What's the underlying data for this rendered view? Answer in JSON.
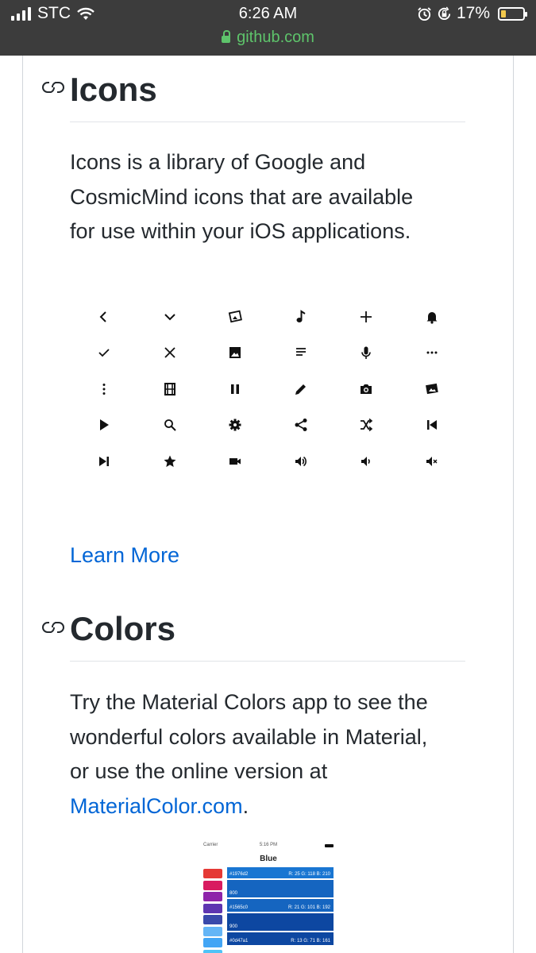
{
  "status_bar": {
    "carrier": "STC",
    "time": "6:26 AM",
    "battery": "17%",
    "url": "github.com"
  },
  "sections": {
    "icons": {
      "heading": "Icons",
      "line1": "Icons is a library of Google and",
      "line2": "CosmicMind icons that are available",
      "line3": "for use within your iOS applications.",
      "learn_more": "Learn More",
      "grid": [
        "chevron-left-icon",
        "chevron-down-icon",
        "photo-library-icon",
        "music-note-icon",
        "plus-icon",
        "bell-icon",
        "check-icon",
        "close-icon",
        "image-icon",
        "menu-lines-icon",
        "microphone-icon",
        "more-horizontal-icon",
        "more-vertical-icon",
        "movie-icon",
        "pause-icon",
        "pencil-icon",
        "camera-icon",
        "photo-library-icon",
        "play-icon",
        "search-icon",
        "settings-icon",
        "share-icon",
        "shuffle-icon",
        "skip-back-icon",
        "skip-forward-icon",
        "star-icon",
        "video-icon",
        "volume-up-icon",
        "volume-down-icon",
        "volume-off-icon"
      ]
    },
    "colors": {
      "heading": "Colors",
      "line1": "Try the Material Colors app to see the",
      "line2": "wonderful colors available in Material,",
      "line3": "or use the online version at",
      "link": "MaterialColor.com",
      "link_suffix": "."
    }
  },
  "preview": {
    "carrier": "Carrier",
    "time": "5:16 PM",
    "title": "Blue",
    "rows": [
      {
        "left": "#1976d2",
        "right": "R: 25 G: 118 B: 210",
        "color": "#1976d2"
      },
      {
        "left": "800",
        "right": "",
        "color": "#1565c0"
      },
      {
        "left": "#1565c0",
        "right": "R: 21 G: 101 B: 192",
        "color": "#1565c0"
      },
      {
        "left": "900",
        "right": "",
        "color": "#0d47a1"
      },
      {
        "left": "#0d47a1",
        "right": "R: 13 G: 71 B: 161",
        "color": "#0d47a1"
      }
    ],
    "swatch_colors": [
      "#e53935",
      "#d81b60",
      "#8e24aa",
      "#5e35b1",
      "#3949ab",
      "#64b5f6",
      "#42a5f5",
      "#4fc3f7"
    ]
  },
  "colors": {
    "link": "#0366d6",
    "url_green": "#5ec46b",
    "status_bg": "#3c3c3c"
  }
}
